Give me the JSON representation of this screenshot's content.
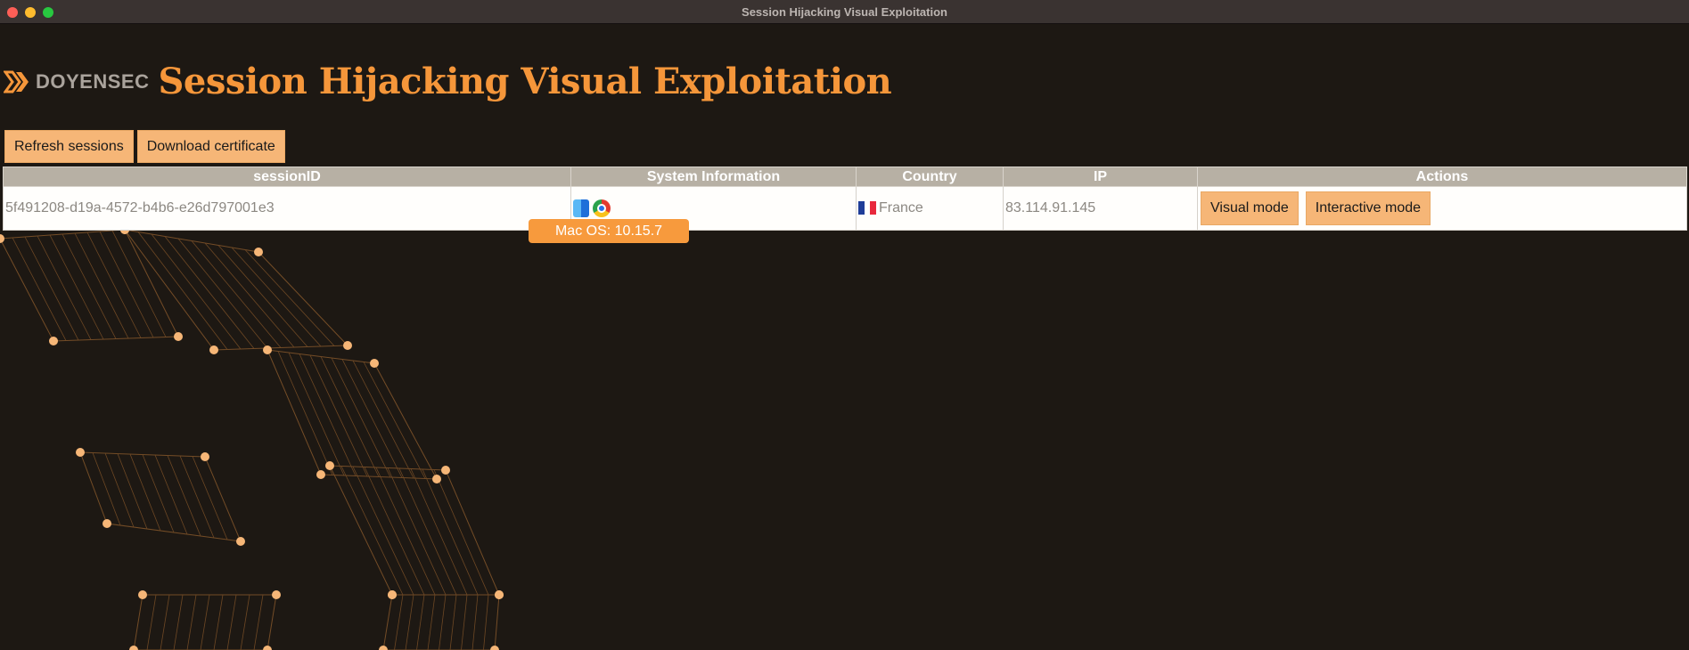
{
  "window": {
    "title": "Session Hijacking Visual Exploitation"
  },
  "header": {
    "brand": "DOYENSEC",
    "title": "Session Hijacking Visual Exploitation"
  },
  "toolbar": {
    "refresh_label": "Refresh sessions",
    "download_label": "Download certificate"
  },
  "table": {
    "columns": [
      "sessionID",
      "System Information",
      "Country",
      "IP",
      "Actions"
    ],
    "rows": [
      {
        "session_id": "5f491208-d19a-4572-b4b6-e26d797001e3",
        "os_icon": "finder-icon",
        "browser_icon": "chrome-icon",
        "country": "France",
        "ip": "83.114.91.145",
        "visual_label": "Visual mode",
        "interactive_label": "Interactive mode"
      }
    ]
  },
  "tooltip": {
    "text": "Mac OS: 10.15.7"
  },
  "colors": {
    "accent": "#f5963a",
    "button": "#f6b677",
    "background": "#1d1813",
    "header": "#b7b0a4"
  }
}
